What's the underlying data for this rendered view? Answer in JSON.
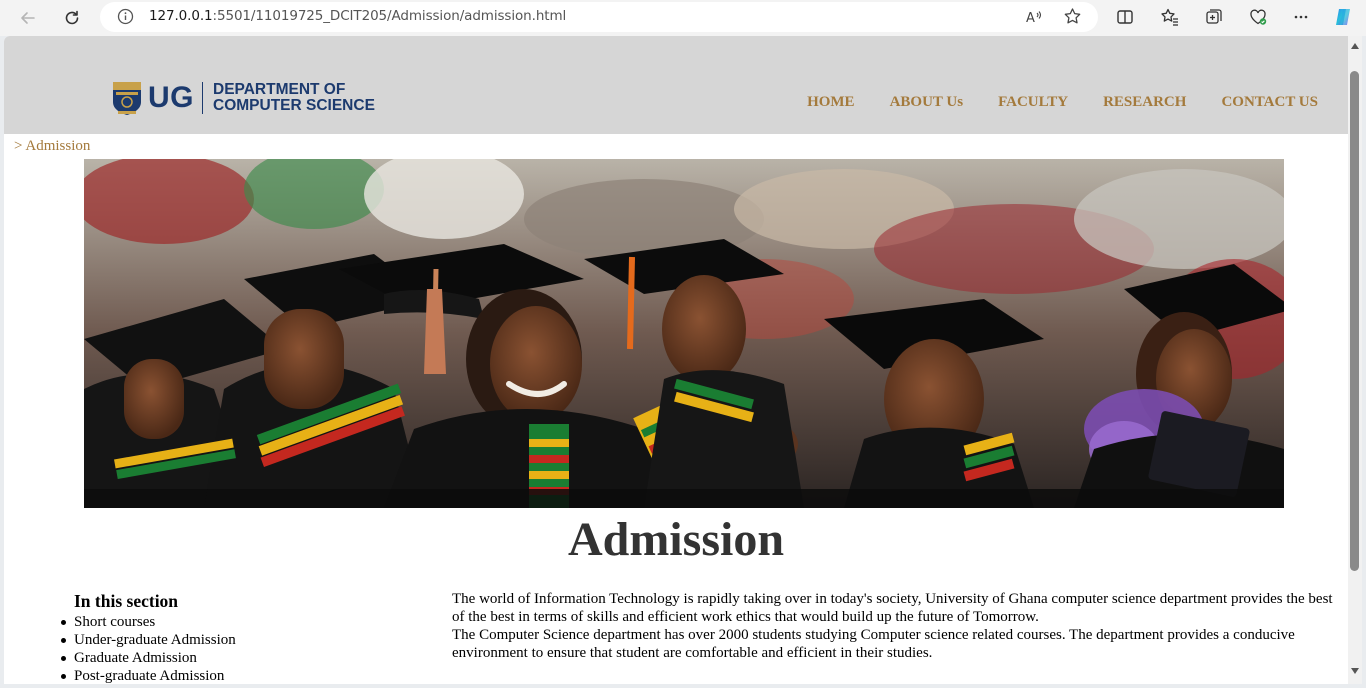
{
  "browser": {
    "url_prefix": "127.0.0.1",
    "url_rest": ":5501/11019725_DCIT205/Admission/admission.html"
  },
  "header": {
    "logo_ug": "UG",
    "logo_line1": "DEPARTMENT OF",
    "logo_line2": "COMPUTER SCIENCE",
    "nav": [
      "HOME",
      "ABOUT Us",
      "FACULTY",
      "RESEARCH",
      "CONTACT US"
    ]
  },
  "breadcrumb": "> Admission",
  "page_title": "Admission",
  "sidebar": {
    "heading": "In this section",
    "items": [
      "Short courses",
      "Under-graduate Admission",
      "Graduate Admission",
      "Post-graduate Admission"
    ]
  },
  "intro": {
    "p1": "The world of Information Technology is rapidly taking over in today's society, University of Ghana computer science department provides the best of the best in terms of skills and efficient work ethics that would build up the future of Tomorrow.",
    "p2": "The Computer Science department has over 2000 students studying Computer science related courses. The department provides a conducive environment to ensure that student are comfortable and efficient in their studies."
  },
  "colors": {
    "header_bg": "#d6d6d6",
    "nav_text": "#a47a3c",
    "logo_blue": "#1c3a6e",
    "title_text": "#333333"
  }
}
